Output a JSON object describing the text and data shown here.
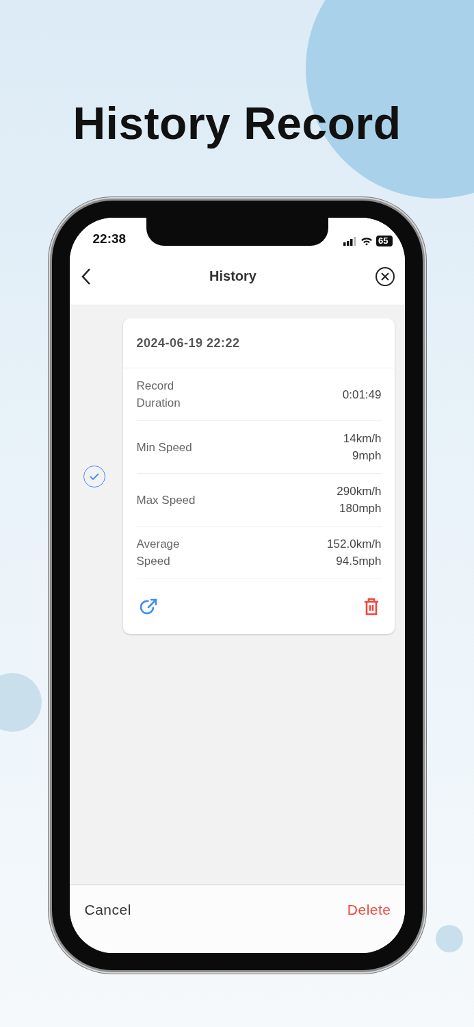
{
  "headline": "History Record",
  "status_bar": {
    "time": "22:38",
    "battery": "65"
  },
  "nav": {
    "title": "History"
  },
  "records": [
    {
      "selected": true,
      "date": "2024-06-19 22:22",
      "rows": [
        {
          "label": "Record Duration",
          "values": [
            "0:01:49"
          ]
        },
        {
          "label": "Min Speed",
          "values": [
            "14km/h",
            "9mph"
          ]
        },
        {
          "label": "Max Speed",
          "values": [
            "290km/h",
            "180mph"
          ]
        },
        {
          "label": "Average Speed",
          "values": [
            "152.0km/h",
            "94.5mph"
          ]
        }
      ]
    }
  ],
  "footer": {
    "cancel": "Cancel",
    "delete": "Delete"
  }
}
